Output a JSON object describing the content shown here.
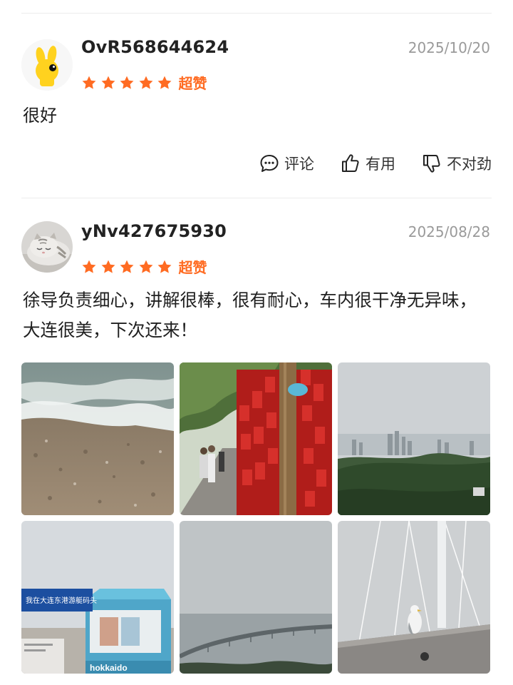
{
  "theme": {
    "star_color": "#ff6b22",
    "rating_label_color": "#ff6b22"
  },
  "reviews": [
    {
      "username": "OvR568644624",
      "date": "2025/10/20",
      "stars": 5,
      "rating_label": "超赞",
      "text": "很好",
      "avatar_icon": "yellow-glove-mascot",
      "actions": {
        "comment": "评论",
        "useful": "有用",
        "report": "不对劲"
      }
    },
    {
      "username": "yNv427675930",
      "date": "2025/08/28",
      "stars": 5,
      "rating_label": "超赞",
      "text": "徐导负责细心，讲解很棒，很有耐心，车内很干净无异味，大连很美，下次还来！",
      "avatar_icon": "sleeping-cat-photo",
      "photos": [
        {
          "scene": "sea-waves-pebble-beach"
        },
        {
          "scene": "red-wish-plaques-wall"
        },
        {
          "scene": "city-skyline-from-hill"
        },
        {
          "scene": "food-kiosk-with-sign",
          "sign_text": "我在大连东港游艇码头",
          "brand_text": "hokkaido"
        },
        {
          "scene": "sea-bridge-overcast"
        },
        {
          "scene": "seagull-on-rope-structure"
        }
      ]
    }
  ]
}
